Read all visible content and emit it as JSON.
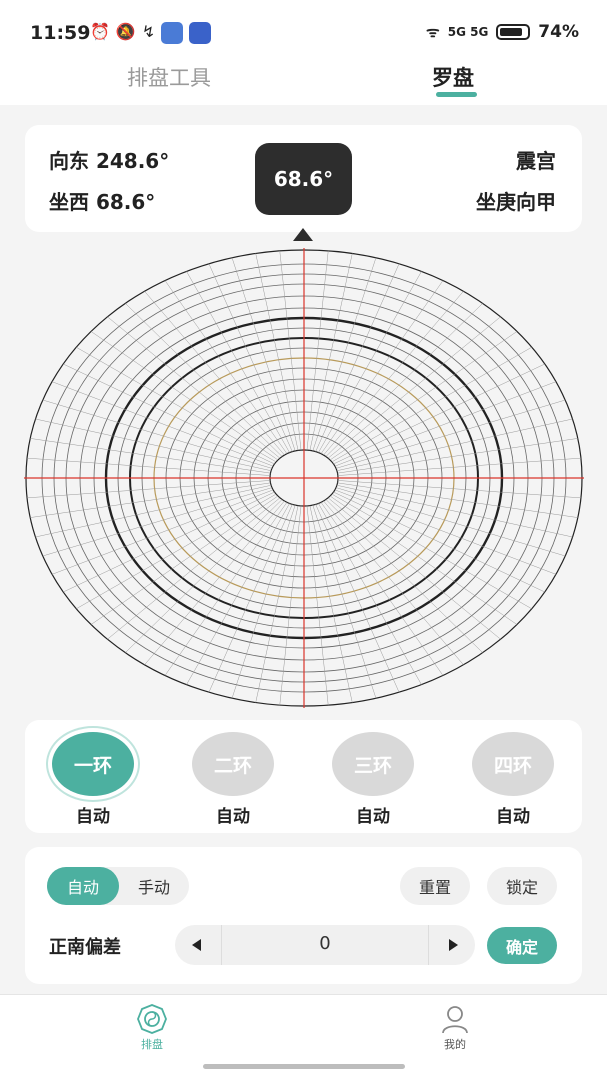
{
  "status_bar": {
    "time": "11:59",
    "battery": "74%",
    "network": "5G 5G"
  },
  "tabs": [
    {
      "label": "排盘工具",
      "active": false
    },
    {
      "label": "罗盘",
      "active": true
    }
  ],
  "info": {
    "facing": "向东 248.6°",
    "sitting": "坐西 68.6°",
    "palace": "震宫",
    "mountain": "坐庚向甲",
    "heading": "68.6°"
  },
  "rings": [
    {
      "name": "一环",
      "mode": "自动",
      "active": true
    },
    {
      "name": "二环",
      "mode": "自动",
      "active": false
    },
    {
      "name": "三环",
      "mode": "自动",
      "active": false
    },
    {
      "name": "四环",
      "mode": "自动",
      "active": false
    }
  ],
  "controls": {
    "mode_auto": "自动",
    "mode_manual": "手动",
    "reset": "重置",
    "lock": "锁定",
    "deviation_label": "正南偏差",
    "deviation_value": "0",
    "confirm": "确定"
  },
  "nav": [
    {
      "label": "排盘",
      "icon": "bagua-icon",
      "active": true
    },
    {
      "label": "我的",
      "icon": "user-icon",
      "active": false
    }
  ],
  "colors": {
    "accent": "#4cb0a0",
    "dark": "#2d2d2d",
    "inactive_ring": "#d9d9d9"
  }
}
